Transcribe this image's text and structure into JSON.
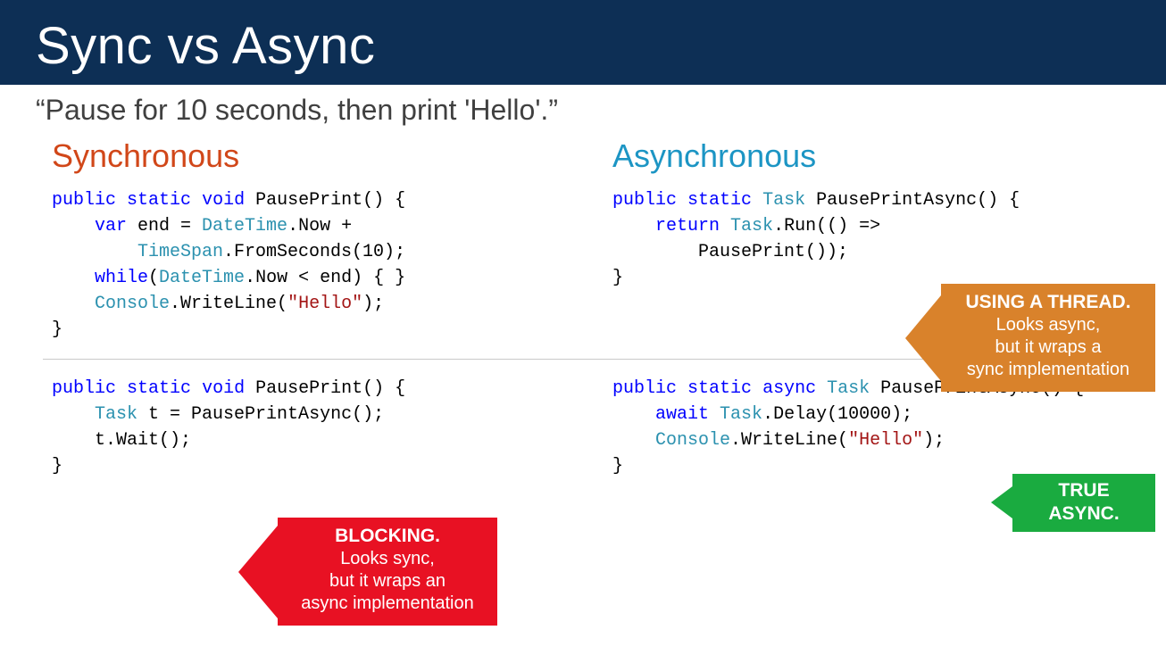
{
  "title": "Sync vs Async",
  "subtitle": "“Pause for 10 seconds, then print 'Hello'.”",
  "columns": {
    "sync_heading": "Synchronous",
    "async_heading": "Asynchronous"
  },
  "code": {
    "sync_top": {
      "l1a": "public",
      "l1b": "static",
      "l1c": "void",
      "l1d": " PausePrint() {",
      "l2a": "var",
      "l2b": " end = ",
      "l2c": "DateTime",
      "l2d": ".Now +",
      "l3a": "TimeSpan",
      "l3b": ".FromSeconds(10);",
      "l4a": "while",
      "l4b": "(",
      "l4c": "DateTime",
      "l4d": ".Now < end) { }",
      "l5a": "Console",
      "l5b": ".WriteLine(",
      "l5c": "\"Hello\"",
      "l5d": ");",
      "l6": "}"
    },
    "async_top": {
      "l1a": "public",
      "l1b": "static",
      "l1c": "Task",
      "l1d": " PausePrintAsync() {",
      "l2a": "return",
      "l2b": "Task",
      "l2c": ".Run(() =>",
      "l3": "PausePrint());",
      "l4": "}"
    },
    "sync_bottom": {
      "l1a": "public",
      "l1b": "static",
      "l1c": "void",
      "l1d": " PausePrint() {",
      "l2a": "Task",
      "l2b": " t = PausePrintAsync();",
      "l3": "t.Wait();",
      "l4": "}"
    },
    "async_bottom": {
      "l1a": "public",
      "l1b": "static",
      "l1c": "async",
      "l1d": "Task",
      "l1e": " PausePrintAsync() {",
      "l2a": "await",
      "l2b": "Task",
      "l2c": ".Delay(10000);",
      "l3a": "Console",
      "l3b": ".WriteLine(",
      "l3c": "\"Hello\"",
      "l3d": ");",
      "l4": "}"
    }
  },
  "callouts": {
    "orange_title": "USING A THREAD.",
    "orange_l1": "Looks async,",
    "orange_l2": "but it wraps a",
    "orange_l3": "sync implementation",
    "red_title": "BLOCKING.",
    "red_l1": "Looks sync,",
    "red_l2": "but it wraps an",
    "red_l3": "async implementation",
    "green_title": "TRUE ASYNC."
  }
}
